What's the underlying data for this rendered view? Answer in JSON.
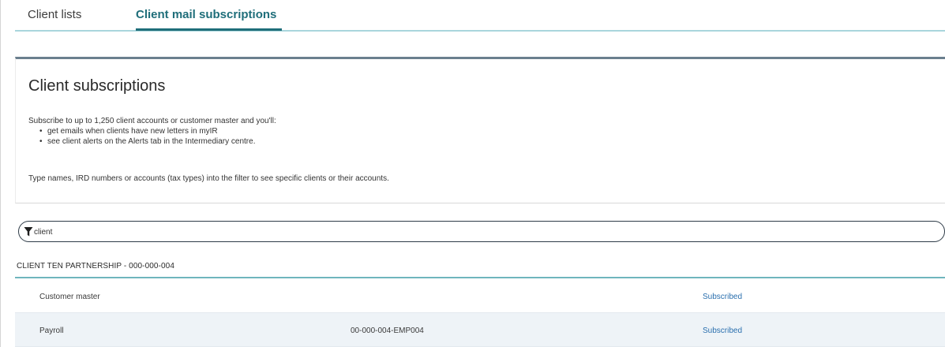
{
  "tabs": [
    {
      "label": "Client lists",
      "active": false
    },
    {
      "label": "Client mail subscriptions",
      "active": true
    }
  ],
  "panel": {
    "title": "Client subscriptions",
    "intro": "Subscribe to up to 1,250 client accounts or customer master and you'll:",
    "bullets": [
      "get emails when clients have new letters in myIR",
      "see client alerts on the Alerts tab in the Intermediary centre."
    ],
    "hint": "Type names, IRD numbers or accounts (tax types) into the filter to see specific clients or their accounts."
  },
  "filter": {
    "icon": "filter-icon",
    "value": "client"
  },
  "client": {
    "header": "CLIENT TEN PARTNERSHIP - 000-000-004",
    "rows": [
      {
        "name": "Customer master",
        "account": "",
        "status": "Subscribed"
      },
      {
        "name": "Payroll",
        "account": "00-000-004-EMP004",
        "status": "Subscribed"
      }
    ]
  },
  "colors": {
    "accent": "#1f6e7a",
    "tab_rule": "#a9d6dc",
    "panel_top_rule": "#6b7f8e",
    "link": "#2a6fae",
    "row_alt": "#eef3f7"
  }
}
